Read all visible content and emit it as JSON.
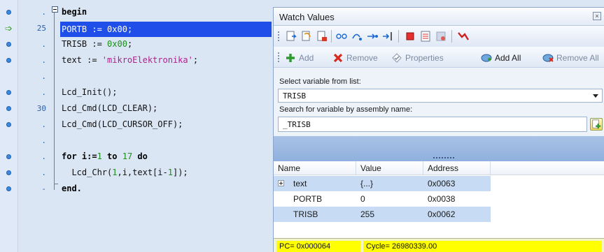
{
  "editor": {
    "line_numbers": [
      ".",
      "25",
      ".",
      ".",
      ".",
      ".",
      "30",
      ".",
      ".",
      ".",
      ".",
      "-"
    ],
    "lines": [
      [
        {
          "t": "begin",
          "c": "kw"
        }
      ],
      [
        {
          "t": "PORTB := ",
          "c": ""
        },
        {
          "t": "0x00",
          "c": ""
        },
        {
          "t": ";",
          "c": ""
        }
      ],
      [
        {
          "t": "TRISB := ",
          "c": ""
        },
        {
          "t": "0x00",
          "c": "num"
        },
        {
          "t": ";",
          "c": ""
        }
      ],
      [
        {
          "t": "text := ",
          "c": ""
        },
        {
          "t": "'mikroElektronika'",
          "c": "str"
        },
        {
          "t": ";",
          "c": ""
        }
      ],
      [],
      [
        {
          "t": "Lcd_Init();",
          "c": ""
        }
      ],
      [
        {
          "t": "Lcd_Cmd(LCD_CLEAR);",
          "c": ""
        }
      ],
      [
        {
          "t": "Lcd_Cmd(LCD_CURSOR_OFF);",
          "c": ""
        }
      ],
      [],
      [
        {
          "t": "for",
          "c": "kw"
        },
        {
          "t": " i:=",
          "c": "kw"
        },
        {
          "t": "1",
          "c": "num"
        },
        {
          "t": " to ",
          "c": "kw"
        },
        {
          "t": "17",
          "c": "num"
        },
        {
          "t": " do",
          "c": "kw"
        }
      ],
      [
        {
          "t": "  Lcd_Chr(",
          "c": ""
        },
        {
          "t": "1",
          "c": "num"
        },
        {
          "t": ",i,text[i-",
          "c": ""
        },
        {
          "t": "1",
          "c": "num"
        },
        {
          "t": "]);",
          "c": ""
        }
      ],
      [
        {
          "t": "end.",
          "c": "kw"
        }
      ]
    ],
    "markers": [
      "dot",
      "arrow",
      "dot",
      "dot",
      "",
      "dot",
      "dot",
      "dot",
      "",
      "dot",
      "dot",
      "dot"
    ],
    "current_line_index": 1,
    "colors": {
      "background": "#dbe6f5",
      "exec_highlight": "#1f4fe8",
      "number": "#1c8c1c",
      "string": "#b0208c"
    }
  },
  "watch": {
    "title": "Watch Values",
    "close_label": "x",
    "toolbar2": {
      "add": "Add",
      "remove": "Remove",
      "properties": "Properties",
      "add_all": "Add All",
      "remove_all": "Remove All"
    },
    "select_label": "Select variable from list:",
    "select_value": "TRISB",
    "search_label": "Search for variable by assembly name:",
    "search_value": "_TRISB",
    "splitter_grip": ",,,,,,,,,,,",
    "columns": [
      "Name",
      "Value",
      "Address"
    ],
    "rows": [
      {
        "name": "text",
        "value": "{...}",
        "address": "0x0063",
        "expandable": true
      },
      {
        "name": "PORTB",
        "value": "0",
        "address": "0x0038",
        "expandable": false
      },
      {
        "name": "TRISB",
        "value": "255",
        "address": "0x0062",
        "expandable": false
      }
    ],
    "status": {
      "pc": "PC= 0x000064",
      "cycle": "Cycle= 26980339.00"
    }
  }
}
